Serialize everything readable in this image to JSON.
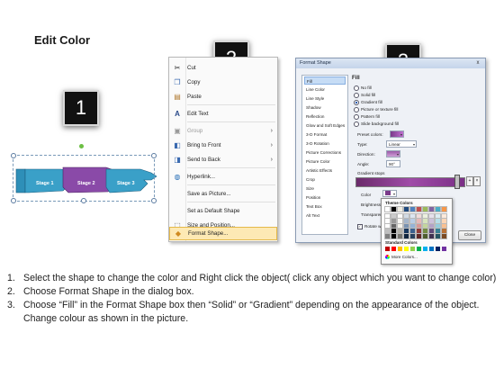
{
  "title": "Edit Color",
  "steps": [
    "1",
    "2",
    "3"
  ],
  "hands": {
    "labels": [
      "Stage 1",
      "Stage 2",
      "Stage 3"
    ],
    "colors": {
      "blue": "#3aa0c8",
      "purple": "#8a4aa8"
    }
  },
  "context_menu": {
    "items": [
      {
        "label": "Cut",
        "icon": "scissors-icon",
        "glyph": "✂",
        "disabled": false,
        "submenu": false
      },
      {
        "label": "Copy",
        "icon": "copy-icon",
        "glyph": "❐",
        "disabled": false,
        "submenu": false
      },
      {
        "label": "Paste",
        "icon": "paste-icon",
        "glyph": "📋",
        "disabled": false,
        "submenu": false
      },
      {
        "label": "Edit Text",
        "icon": "edit-text-icon",
        "glyph": "A",
        "disabled": false,
        "submenu": false
      },
      {
        "label": "Group",
        "icon": "group-icon",
        "glyph": "▣",
        "disabled": true,
        "submenu": true
      },
      {
        "label": "Bring to Front",
        "icon": "bring-front-icon",
        "glyph": "◧",
        "disabled": false,
        "submenu": true
      },
      {
        "label": "Send to Back",
        "icon": "send-back-icon",
        "glyph": "◨",
        "disabled": false,
        "submenu": true
      },
      {
        "label": "Hyperlink...",
        "icon": "hyperlink-icon",
        "glyph": "🌐",
        "disabled": false,
        "submenu": false
      },
      {
        "label": "Save as Picture...",
        "icon": "",
        "glyph": "",
        "disabled": false,
        "submenu": false
      },
      {
        "label": "Set as Default Shape",
        "icon": "",
        "glyph": "",
        "disabled": false,
        "submenu": false
      },
      {
        "label": "Size and Position...",
        "icon": "size-position-icon",
        "glyph": "⬚",
        "disabled": false,
        "submenu": false
      },
      {
        "label": "Format Shape...",
        "icon": "format-shape-icon",
        "glyph": "◆",
        "disabled": false,
        "submenu": false,
        "highlighted": true
      }
    ]
  },
  "dialog": {
    "title": "Format Shape",
    "close_x": "x",
    "categories": [
      "Fill",
      "Line Color",
      "Line Style",
      "Shadow",
      "Reflection",
      "Glow and Soft Edges",
      "3-D Format",
      "3-D Rotation",
      "Picture Corrections",
      "Picture Color",
      "Artistic Effects",
      "Crop",
      "Size",
      "Position",
      "Text Box",
      "Alt Text"
    ],
    "selected_category": "Fill",
    "section": "Fill",
    "fill_options": [
      {
        "label": "No fill",
        "on": false
      },
      {
        "label": "Solid fill",
        "on": false
      },
      {
        "label": "Gradient fill",
        "on": true
      },
      {
        "label": "Picture or texture fill",
        "on": false
      },
      {
        "label": "Pattern fill",
        "on": false
      },
      {
        "label": "Slide background fill",
        "on": false
      }
    ],
    "preset_colors_label": "Preset colors:",
    "type_label": "Type:",
    "type_value": "Linear",
    "direction_label": "Direction:",
    "angle_label": "Angle:",
    "angle_value": "90°",
    "gradient_stops_label": "Gradient stops",
    "color_label": "Color",
    "brightness_label": "Brightness",
    "transparency_label": "Transparency",
    "rotate_label": "Rotate with shape",
    "close_button": "Close"
  },
  "color_popup": {
    "theme_label": "Theme Colors",
    "standard_label": "Standard Colors",
    "more_colors": "More Colors...",
    "theme_top": [
      "#ffffff",
      "#000000",
      "#eeece1",
      "#1f497d",
      "#4f81bd",
      "#c0504d",
      "#9bbb59",
      "#8064a2",
      "#4bacc6",
      "#f79646"
    ],
    "standard": [
      "#c00000",
      "#ff0000",
      "#ffc000",
      "#ffff00",
      "#92d050",
      "#00b050",
      "#00b0f0",
      "#0070c0",
      "#002060",
      "#7030a0"
    ]
  },
  "instructions": [
    {
      "num": "1.",
      "text": "Select the shape to change the color and Right click the object( click any object which you want to change color)"
    },
    {
      "num": "2.",
      "text": "Choose Format Shape in the dialog box."
    },
    {
      "num": "3.",
      "text": "Choose “Fill” in the Format Shape box then “Solid” or “Gradient” depending on the appearance of the object. Change colour as shown in the picture."
    }
  ]
}
